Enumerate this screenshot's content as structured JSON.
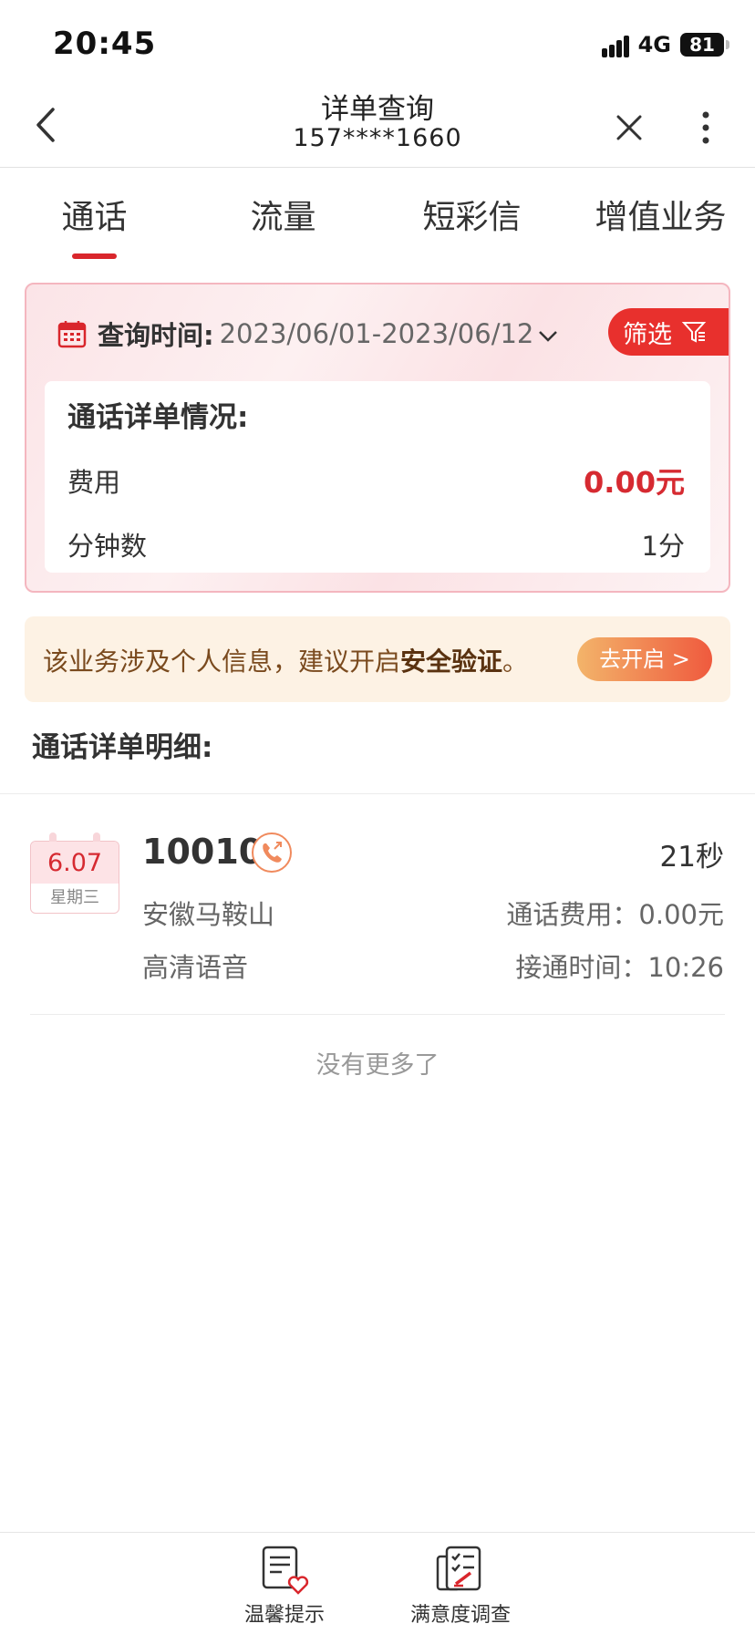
{
  "status": {
    "time": "20:45",
    "network": "4G",
    "battery": "81"
  },
  "nav": {
    "title": "详单查询",
    "subtitle": "157****1660"
  },
  "tabs": [
    {
      "label": "通话",
      "active": true
    },
    {
      "label": "流量",
      "active": false
    },
    {
      "label": "短彩信",
      "active": false
    },
    {
      "label": "增值业务",
      "active": false
    }
  ],
  "summary": {
    "query_label": "查询时间:",
    "query_range": "2023/06/01-2023/06/12",
    "filter_label": "筛选",
    "title": "通话详单情况:",
    "rows": [
      {
        "label": "费用",
        "value": "0.00元"
      },
      {
        "label": "分钟数",
        "value": "1分"
      }
    ]
  },
  "notice": {
    "text_prefix": "该业务涉及个人信息，建议开启",
    "text_bold": "安全验证",
    "text_suffix": "。",
    "button": "去开启 >"
  },
  "detail_title": "通话详单明细:",
  "records": [
    {
      "date": "6.07",
      "weekday": "星期三",
      "number": "10010",
      "duration": "21秒",
      "location": "安徽马鞍山",
      "fee": "通话费用：0.00元",
      "type": "高清语音",
      "connect_time": "接通时间：10:26"
    }
  ],
  "no_more": "没有更多了",
  "bottom_bar": [
    {
      "label": "温馨提示",
      "icon": "tips-heart-icon"
    },
    {
      "label": "满意度调查",
      "icon": "survey-clipboard-icon"
    }
  ],
  "colors": {
    "accent": "#d9262c",
    "card_border": "#f4b6bf",
    "notice_bg": "#fdf2e4"
  }
}
